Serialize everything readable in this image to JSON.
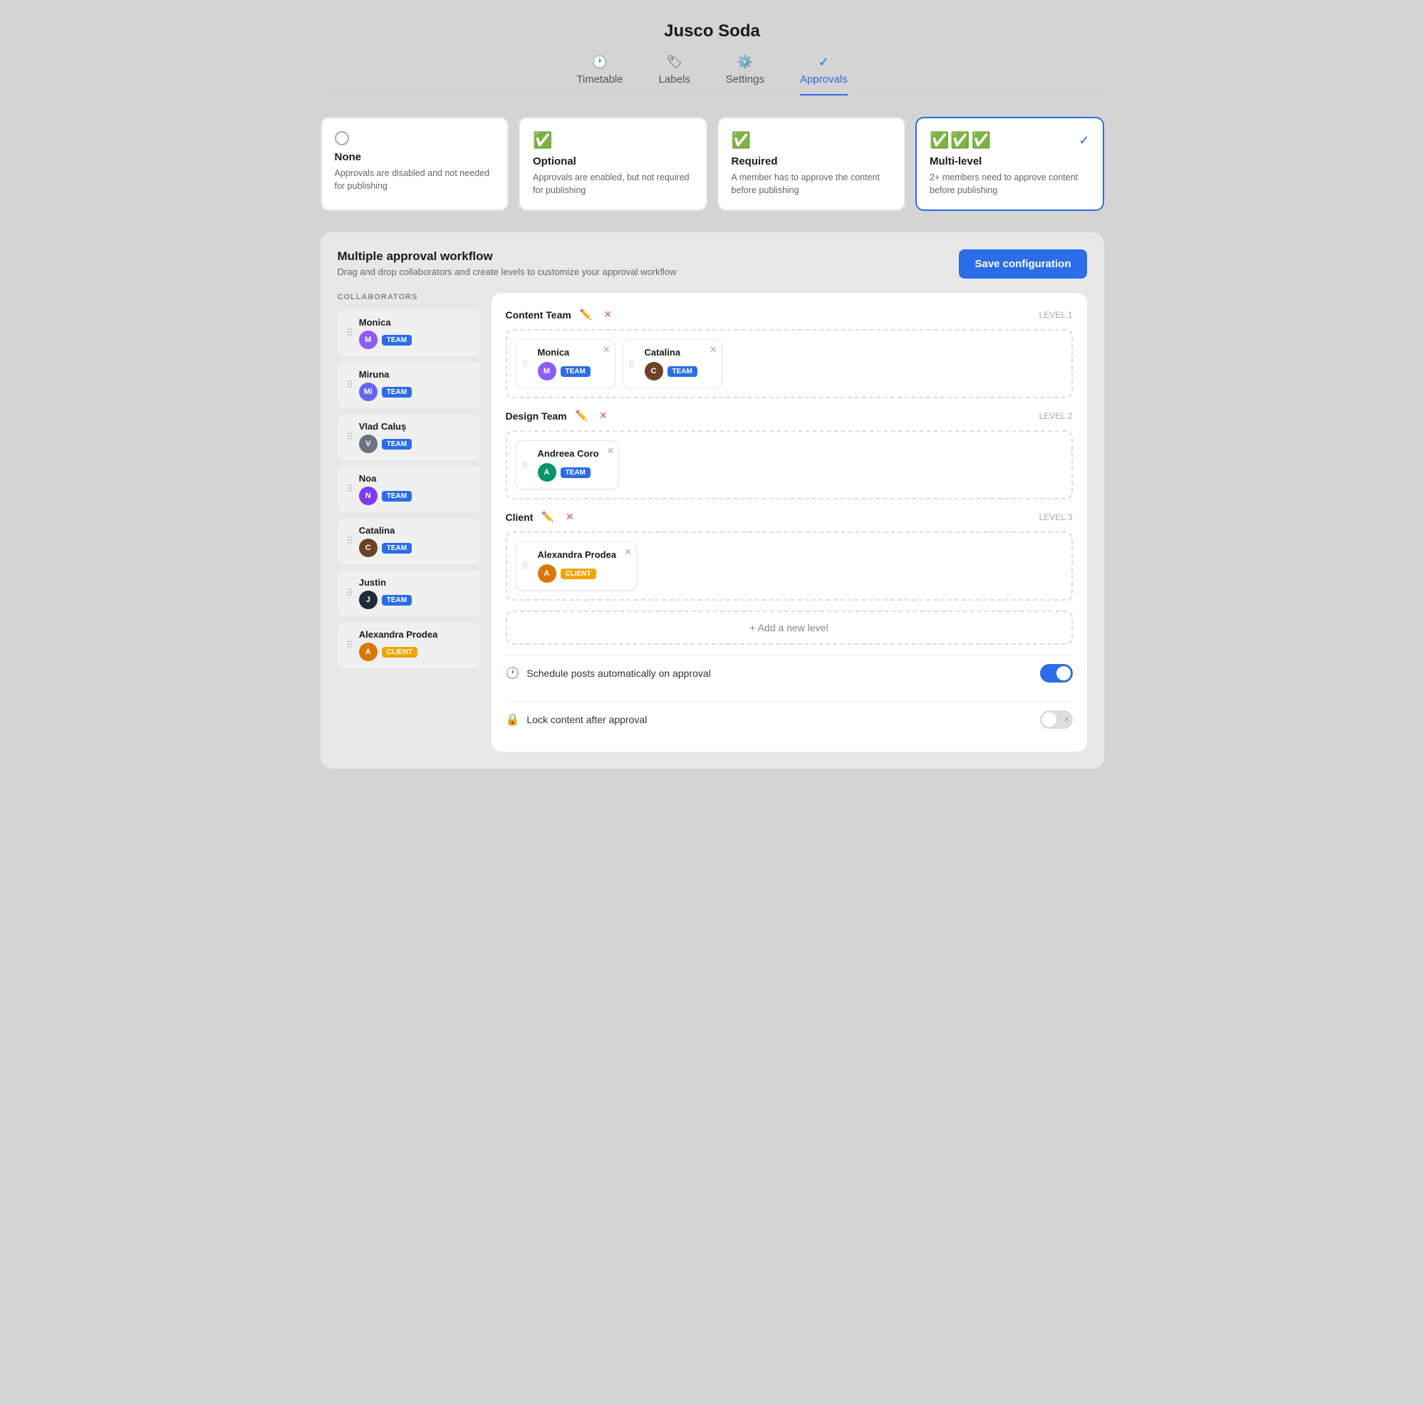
{
  "app": {
    "title": "Jusco Soda"
  },
  "nav": {
    "tabs": [
      {
        "id": "timetable",
        "label": "Timetable",
        "icon": "🕐",
        "active": false
      },
      {
        "id": "labels",
        "label": "Labels",
        "icon": "🏷",
        "active": false
      },
      {
        "id": "settings",
        "label": "Settings",
        "icon": "⚙️",
        "active": false
      },
      {
        "id": "approvals",
        "label": "Approvals",
        "icon": "✓",
        "active": true
      }
    ]
  },
  "approval_options": [
    {
      "id": "none",
      "title": "None",
      "desc": "Approvals are disabled and not needed for publishing",
      "selected": false
    },
    {
      "id": "optional",
      "title": "Optional",
      "desc": "Approvals are enabled, but not required for publishing",
      "selected": false
    },
    {
      "id": "required",
      "title": "Required",
      "desc": "A member has to approve the content before publishing",
      "selected": false
    },
    {
      "id": "multilevel",
      "title": "Multi-level",
      "desc": "2+ members need to approve content before publishing",
      "selected": true
    }
  ],
  "workflow": {
    "title": "Multiple approval workflow",
    "desc": "Drag and drop collaborators and create levels to customize your approval workflow",
    "save_label": "Save configuration"
  },
  "collaborators_label": "COLLABORATORS",
  "collaborators": [
    {
      "name": "Monica",
      "tag": "TEAM",
      "tag_type": "team",
      "av": "av-monica"
    },
    {
      "name": "Miruna",
      "tag": "TEAM",
      "tag_type": "team",
      "av": "av-miruna"
    },
    {
      "name": "Vlad Caluș",
      "tag": "TEAM",
      "tag_type": "team",
      "av": "av-vlad"
    },
    {
      "name": "Noa",
      "tag": "TEAM",
      "tag_type": "team",
      "av": "av-noa"
    },
    {
      "name": "Catalina",
      "tag": "TEAM",
      "tag_type": "team",
      "av": "av-catalina"
    },
    {
      "name": "Justin",
      "tag": "TEAM",
      "tag_type": "team",
      "av": "av-justin"
    },
    {
      "name": "Alexandra Prodea",
      "tag": "CLIENT",
      "tag_type": "client",
      "av": "av-alexandra"
    }
  ],
  "levels": [
    {
      "name": "Content Team",
      "label": "LEVEL 1",
      "members": [
        {
          "name": "Monica",
          "tag": "TEAM",
          "tag_type": "team",
          "av": "av-monica"
        },
        {
          "name": "Catalina",
          "tag": "TEAM",
          "tag_type": "team",
          "av": "av-catalina"
        }
      ]
    },
    {
      "name": "Design Team",
      "label": "LEVEL 2",
      "members": [
        {
          "name": "Andreea Coro",
          "tag": "TEAM",
          "tag_type": "team",
          "av": "av-andreea"
        }
      ]
    },
    {
      "name": "Client",
      "label": "LEVEL 3",
      "members": [
        {
          "name": "Alexandra Prodea",
          "tag": "CLIENT",
          "tag_type": "client",
          "av": "av-alexandra"
        }
      ]
    }
  ],
  "add_level_label": "+ Add a new level",
  "settings_items": [
    {
      "id": "schedule",
      "icon": "🕐",
      "label": "Schedule posts automatically on approval",
      "toggle": "on"
    },
    {
      "id": "lock",
      "icon": "🔒",
      "label": "Lock content after approval",
      "toggle": "off"
    }
  ]
}
